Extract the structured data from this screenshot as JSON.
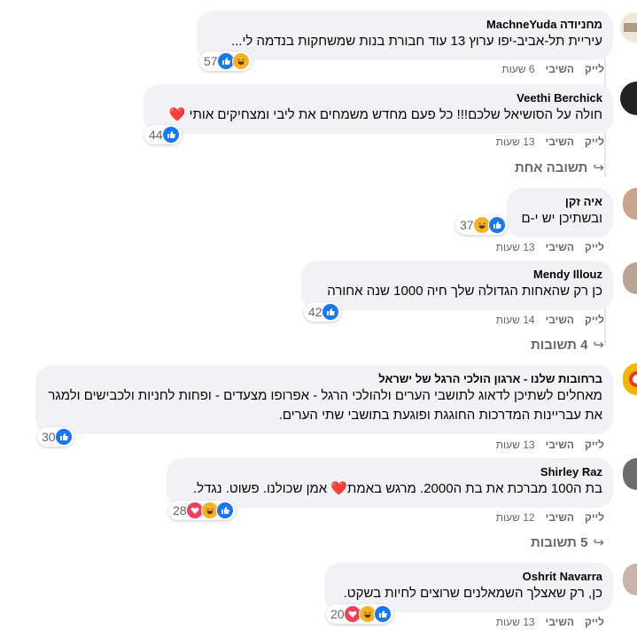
{
  "comments": [
    {
      "author": "מחניודה MachneYuda",
      "text": "עיריית תל-אביב-יפו ערוץ 13 עוד חבורת בנות שמשחקות בנדמה לי...",
      "reaction_count": "57",
      "reactions": [
        "haha-icon",
        "like-icon"
      ],
      "like": "לייק",
      "reply": "השיבי",
      "time": "6 שעות"
    },
    {
      "author": "Veethi Berchick",
      "text": "חולה על הסושיאל שלכם!!! כל פעם מחדש משמחים את ליבי ומצחיקים אותי ❤️",
      "reaction_count": "44",
      "reactions": [
        "like-icon"
      ],
      "like": "לייק",
      "reply": "השיבי",
      "time": "13 שעות",
      "replies_label": "תשובה אחת"
    },
    {
      "author": "איה זקן",
      "text": "ובשתיכן יש י-ם",
      "reaction_count": "37",
      "reactions": [
        "like-icon",
        "haha-icon"
      ],
      "like": "לייק",
      "reply": "השיבי",
      "time": "13 שעות"
    },
    {
      "author": "Mendy Illouz",
      "text": "כן רק שהאחות הגדולה שלך חיה 1000 שנה אחורה",
      "reaction_count": "42",
      "reactions": [
        "like-icon"
      ],
      "like": "לייק",
      "reply": "השיבי",
      "time": "14 שעות",
      "replies_label": "4 תשובות"
    },
    {
      "author": "ברחובות שלנו - ארגון הולכי הרגל של ישראל",
      "text": "מאחלים לשתיכן לדאוג לתושבי הערים ולהולכי הרגל - אפרופו מצעדים - ופחות לחניות ולכבישים ולמגר את עבריינות המדרכות החוגגת ופוגעת בתושבי שתי הערים.",
      "reaction_count": "30",
      "reactions": [
        "like-icon"
      ],
      "like": "לייק",
      "reply": "השיבי",
      "time": "13 שעות"
    },
    {
      "author": "Shirley Raz",
      "text": "בת ה100 מברכת את בת ה2000. מרגש באמת❤️ אמן שכולנו. פשוט. נגדל.",
      "reaction_count": "28",
      "reactions": [
        "like-icon",
        "haha-icon",
        "love-icon"
      ],
      "like": "לייק",
      "reply": "השיבי",
      "time": "12 שעות",
      "replies_label": "5 תשובות"
    },
    {
      "author": "Oshrit Navarra",
      "text": "כן, רק שאצלך השמאלנים שרוצים לחיות בשקט.",
      "reaction_count": "20",
      "reactions": [
        "like-icon",
        "haha-icon",
        "love-icon"
      ],
      "like": "לייק",
      "reply": "השיבי",
      "time": "13 שעות"
    }
  ],
  "colors": {
    "bubble": "#f0f2f5",
    "meta_text": "#65676b",
    "like_blue": "#1877f2",
    "haha_yellow": "#f7b125",
    "love_red": "#f33e58"
  }
}
